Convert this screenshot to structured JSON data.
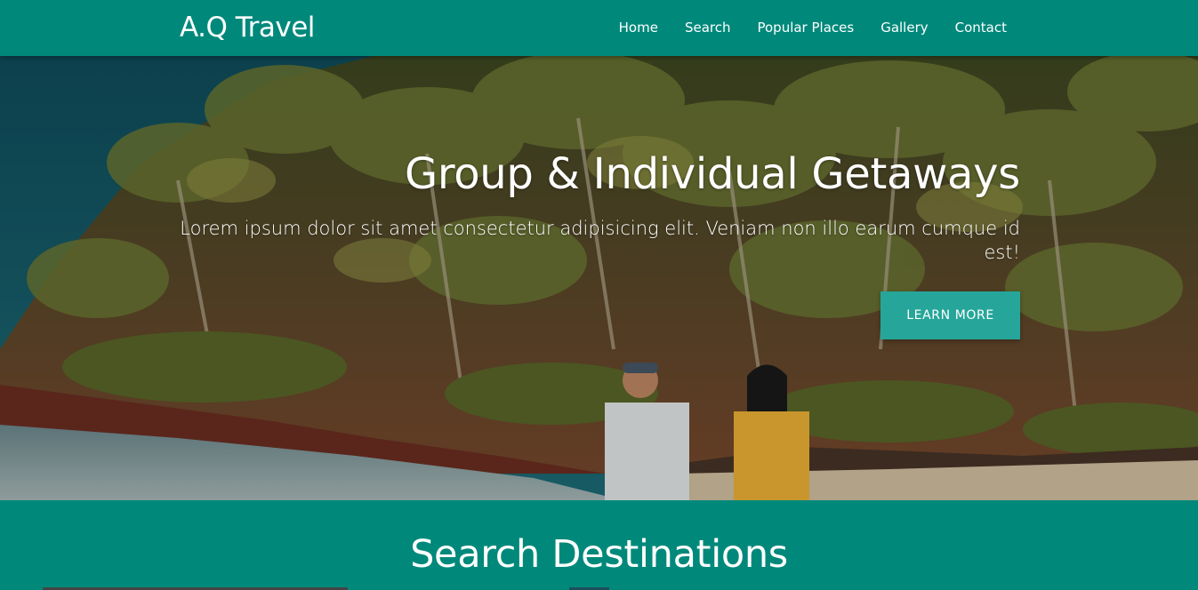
{
  "brand": "A.Q Travel",
  "nav": {
    "items": [
      "Home",
      "Search",
      "Popular Places",
      "Gallery",
      "Contact"
    ]
  },
  "hero": {
    "title": "Group & Individual Getaways",
    "text": "Lorem ipsum dolor sit amet consectetur adipisicing elit. Veniam non illo earum cumque id est!",
    "button_label": "LEARN MORE",
    "image": "photo of a couple walking on a tropical beach with palm-covered hillside"
  },
  "search_section": {
    "title": "Search Destinations"
  },
  "colors": {
    "primary": "#00897b",
    "button": "#26a69a"
  }
}
